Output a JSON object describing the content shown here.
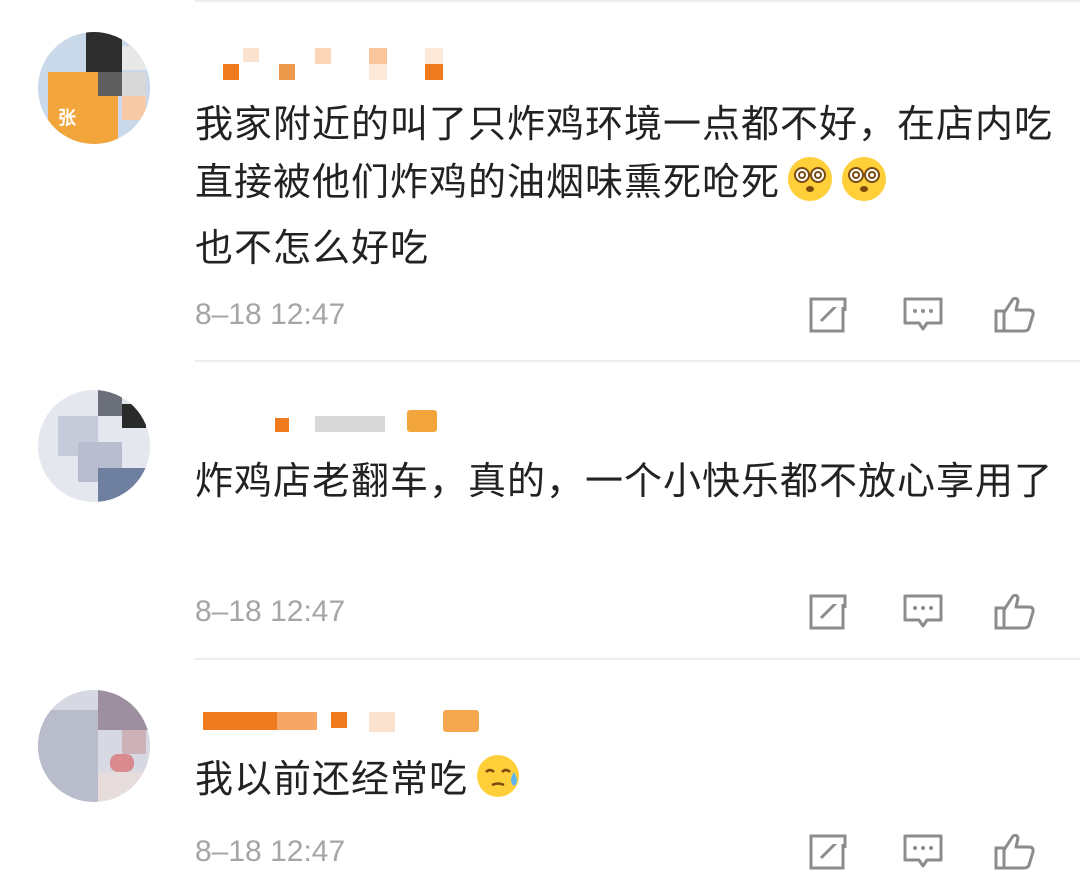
{
  "comments": [
    {
      "text": "我家附近的叫了只炸鸡环境一点都不好，在店内吃直接被他们炸鸡的油烟味熏死呛死",
      "text_tail": "也不怎么好吃",
      "emojis": [
        "dizzy-face-emoji",
        "dizzy-face-emoji"
      ],
      "time": "8–18 12:47",
      "avatar_caption": "张"
    },
    {
      "text": "炸鸡店老翻车，真的，一个小快乐都不放心享用了",
      "time": "8–18 12:47"
    },
    {
      "text": "我以前还经常吃",
      "emojis": [
        "sweat-face-emoji"
      ],
      "time": "8–18 12:47"
    }
  ],
  "icons": {
    "repost": "repost-icon",
    "comment": "comment-icon",
    "like": "thumbs-up-icon"
  },
  "colors": {
    "text": "#222222",
    "meta": "#a5a5a5",
    "accent_orange": "#f07a1e"
  }
}
